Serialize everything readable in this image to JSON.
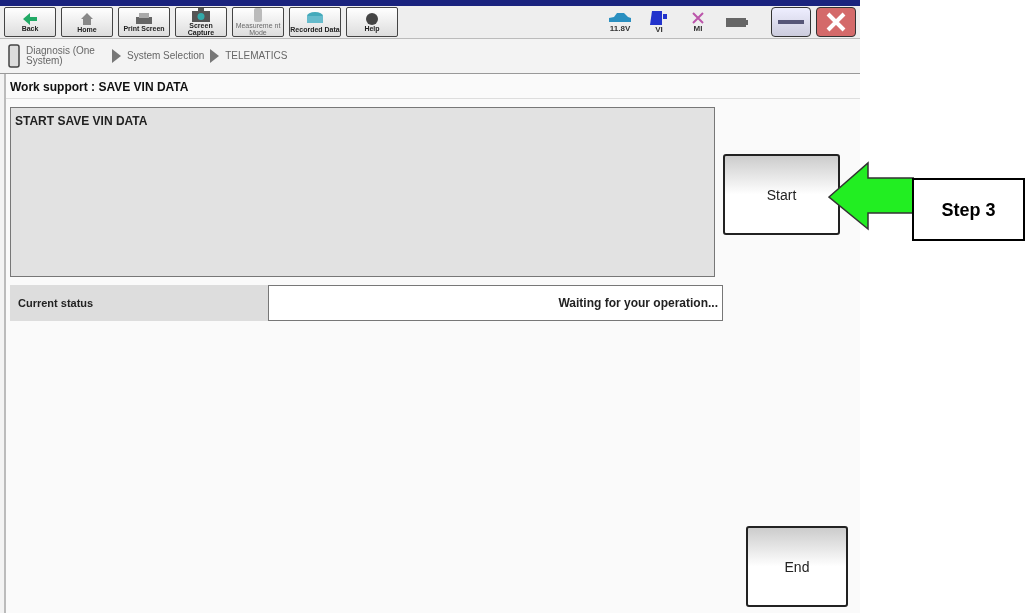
{
  "toolbar": [
    {
      "kind": "back",
      "label": "Back",
      "disabled": false
    },
    {
      "kind": "home",
      "label": "Home",
      "disabled": false
    },
    {
      "kind": "print",
      "label": "Print Screen",
      "disabled": false
    },
    {
      "kind": "camera",
      "label": "Screen Capture",
      "disabled": false
    },
    {
      "kind": "measure",
      "label": "Measureme nt Mode",
      "disabled": true
    },
    {
      "kind": "recorded",
      "label": "Recorded Data",
      "disabled": false
    },
    {
      "kind": "help",
      "label": "Help",
      "disabled": false
    }
  ],
  "indicators": [
    {
      "kind": "car",
      "label": "11.8V"
    },
    {
      "kind": "vi",
      "label": "VI"
    },
    {
      "kind": "mi",
      "label": "MI"
    },
    {
      "kind": "battery"
    }
  ],
  "breadcrumb": [
    "Diagnosis (One System)",
    "System Selection",
    "TELEMATICS"
  ],
  "title": "Work support : SAVE VIN DATA",
  "message": "START SAVE VIN DATA",
  "status": {
    "label": "Current status",
    "value": "Waiting for your operation..."
  },
  "start_button": "Start",
  "end_button": "End",
  "callout": "Step 3"
}
